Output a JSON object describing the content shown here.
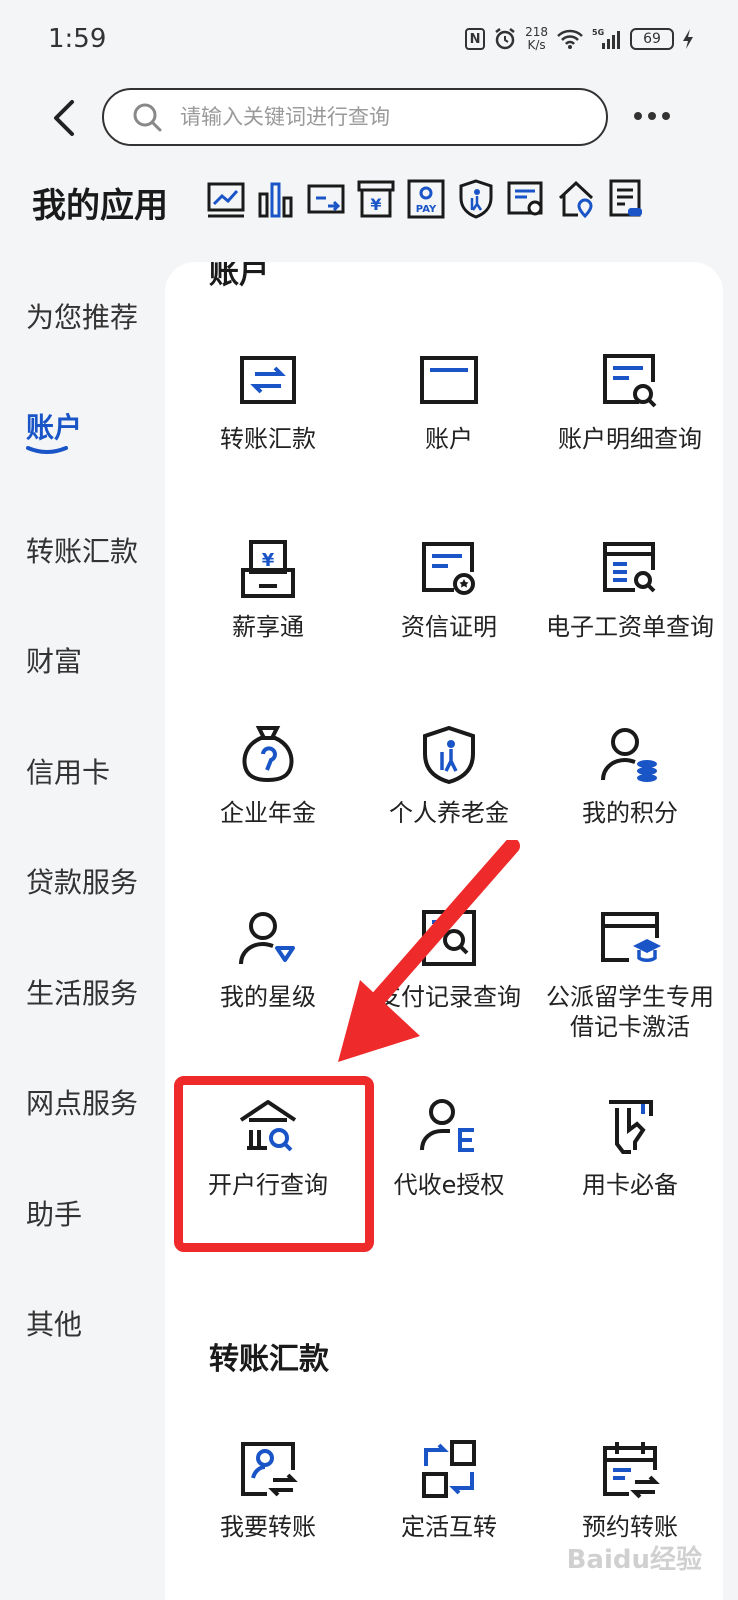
{
  "status_bar": {
    "time": "1:59",
    "nfc": "N",
    "speed_value": "218",
    "speed_unit": "K/s",
    "battery": "69",
    "network": "5G"
  },
  "search": {
    "placeholder": "请输入关键词进行查询"
  },
  "my_apps": {
    "title": "我的应用",
    "icons": [
      "chart-line-icon",
      "bar-chart-icon",
      "card-transfer-icon",
      "yuan-box-icon",
      "pay-icon",
      "shield-elder-icon",
      "certificate-icon",
      "home-location-icon",
      "document-list-icon"
    ],
    "pay_text": "PAY"
  },
  "sidebar": {
    "items": [
      {
        "label": "为您推荐"
      },
      {
        "label": "账户"
      },
      {
        "label": "转账汇款"
      },
      {
        "label": "财富"
      },
      {
        "label": "信用卡"
      },
      {
        "label": "贷款服务"
      },
      {
        "label": "生活服务"
      },
      {
        "label": "网点服务"
      },
      {
        "label": "助手"
      },
      {
        "label": "其他"
      }
    ],
    "active_index": 1
  },
  "section_account": {
    "title": "账户",
    "items": [
      {
        "label": "转账汇款",
        "icon": "transfer-arrows-icon"
      },
      {
        "label": "账户",
        "icon": "card-icon"
      },
      {
        "label": "账户明细查询",
        "icon": "detail-search-icon"
      },
      {
        "label": "薪享通",
        "icon": "salary-pos-icon"
      },
      {
        "label": "资信证明",
        "icon": "credit-certificate-icon"
      },
      {
        "label": "电子工资单查询",
        "icon": "payslip-search-icon"
      },
      {
        "label": "企业年金",
        "icon": "money-bag-icon"
      },
      {
        "label": "个人养老金",
        "icon": "pension-shield-icon"
      },
      {
        "label": "我的积分",
        "icon": "user-coins-icon"
      },
      {
        "label": "我的星级",
        "icon": "user-diamond-icon"
      },
      {
        "label": "支付记录查询",
        "icon": "payment-record-icon"
      },
      {
        "label": "公派留学生专用借记卡激活",
        "icon": "student-card-icon"
      },
      {
        "label": "开户行查询",
        "icon": "bank-search-icon"
      },
      {
        "label": "代收e授权",
        "icon": "user-e-icon"
      },
      {
        "label": "用卡必备",
        "icon": "card-hand-icon"
      }
    ]
  },
  "section_transfer": {
    "title": "转账汇款",
    "items": [
      {
        "label": "我要转账",
        "icon": "user-transfer-icon"
      },
      {
        "label": "定活互转",
        "icon": "fixed-current-swap-icon"
      },
      {
        "label": "预约转账",
        "icon": "scheduled-transfer-icon"
      }
    ]
  },
  "colors": {
    "accent": "#1a55c7",
    "annotation": "#ee2a2a",
    "icon_dark": "#1a1a1a"
  },
  "watermark": "Baidu经验"
}
